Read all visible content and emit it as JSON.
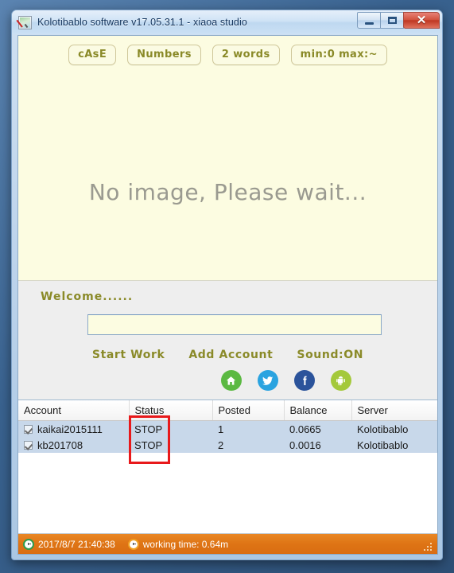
{
  "window": {
    "title": "Kolotibablo software v17.05.31.1 - xiaoa studio",
    "app_icon": "picture-pen-icon",
    "buttons": {
      "minimize": "–",
      "maximize": "□",
      "close": "✕"
    }
  },
  "toolbar": {
    "buttons": [
      {
        "label": "cAsE",
        "name": "case-button"
      },
      {
        "label": "Numbers",
        "name": "numbers-button"
      },
      {
        "label": "2 words",
        "name": "words-button"
      },
      {
        "label": "min:0 max:~",
        "name": "minmax-button"
      }
    ]
  },
  "image_panel": {
    "placeholder_text": "No image, Please wait..."
  },
  "control_panel": {
    "welcome": "Welcome......",
    "answer_input": {
      "value": "",
      "placeholder": ""
    },
    "links": [
      {
        "label": "Start Work",
        "name": "start-work-link"
      },
      {
        "label": "Add Account",
        "name": "add-account-link"
      },
      {
        "label": "Sound:ON",
        "name": "sound-toggle-link"
      }
    ],
    "social": [
      {
        "name": "home-icon",
        "color": "#5bb942"
      },
      {
        "name": "twitter-icon",
        "color": "#2aa3e0"
      },
      {
        "name": "facebook-icon",
        "color": "#2b539b"
      },
      {
        "name": "android-icon",
        "color": "#a4c93a"
      }
    ]
  },
  "table": {
    "columns": [
      "Account",
      "Status",
      "Posted",
      "Balance",
      "Server"
    ],
    "rows": [
      {
        "checked": true,
        "account": "kaikai2015111",
        "status": "STOP",
        "posted": "1",
        "balance": "0.0665",
        "server": "Kolotibablo"
      },
      {
        "checked": true,
        "account": "kb201708",
        "status": "STOP",
        "posted": "2",
        "balance": "0.0016",
        "server": "Kolotibablo"
      }
    ],
    "annotation": {
      "name": "status-column-highlight",
      "color": "#e8191b"
    }
  },
  "statusbar": {
    "time": "2017/8/7 21:40:38",
    "working_time": "working time: 0.64m",
    "time_icon": "clock-icon",
    "work_icon": "clock-icon",
    "accent": "#de7415"
  }
}
